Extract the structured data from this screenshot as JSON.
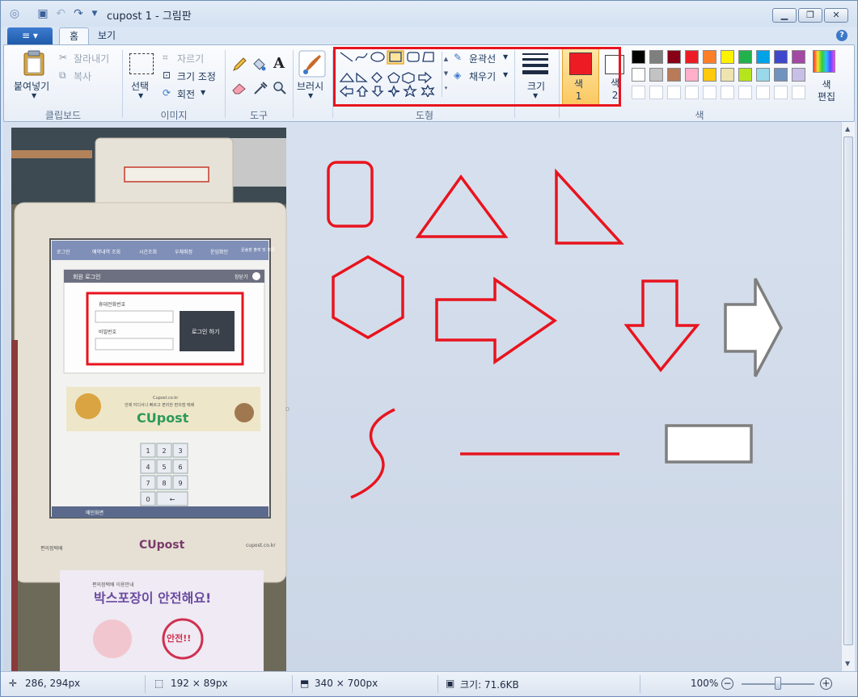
{
  "title_bar": {
    "title": "cupost 1 - 그림판"
  },
  "menu": {
    "file_label": "≡ ▾",
    "tabs": [
      "홈",
      "보기"
    ]
  },
  "clipboard": {
    "paste": "붙여넣기",
    "cut": "잘라내기",
    "copy": "복사",
    "group": "클립보드"
  },
  "image": {
    "select": "선택",
    "crop": "자르기",
    "resize": "크기 조정",
    "rotate": "회전",
    "group": "이미지"
  },
  "tools": {
    "group": "도구"
  },
  "brushes": {
    "label": "브러시"
  },
  "shapes": {
    "outline": "윤곽선",
    "fill": "채우기",
    "group": "도형"
  },
  "size": {
    "label": "크기"
  },
  "colors": {
    "color1_label": "색\n1",
    "color2_label": "색\n2",
    "edit_label": "색\n편집",
    "group": "색",
    "color1": "#ed1c24",
    "color2": "#ffffff",
    "palette_row1": [
      "#000000",
      "#7f7f7f",
      "#880015",
      "#ed1c24",
      "#ff7f27",
      "#fff200",
      "#22b14c",
      "#00a2e8",
      "#3f48cc",
      "#a349a4"
    ],
    "palette_row2": [
      "#ffffff",
      "#c3c3c3",
      "#b97a57",
      "#ffaec9",
      "#ffc90e",
      "#efe4b0",
      "#b5e61d",
      "#99d9ea",
      "#7092be",
      "#c8bfe7"
    ]
  },
  "photo": {
    "kiosk_tabs": [
      "로그인",
      "예약내역 조회",
      "시간조회",
      "우체취정",
      "운임확인",
      "운송장 출력 및 보류"
    ],
    "login_title": "회원 로그인",
    "close": "창닫기",
    "phone_label": "휴대전화번호",
    "password_label": "비밀번호",
    "login_button": "로그인 하기",
    "banner_site": "Cupost.co.kr",
    "banner_text": "언제 어디서나 빠르고 편리한 편의점 택배",
    "brand": "CUpost",
    "keypad": [
      "1",
      "2",
      "3",
      "4",
      "5",
      "6",
      "7",
      "8",
      "9",
      "0",
      "←"
    ],
    "main_screen": "메인화면",
    "footer_left": "편의점택배",
    "footer_right": "cupost.co.kr",
    "poster_small": "편의점택배 이용안내",
    "poster_headline": "박스포장이 안전해요!",
    "stamp": "안전!!"
  },
  "status": {
    "position": "286, 294px",
    "selection": "192 × 89px",
    "image_size": "340 × 700px",
    "file_size": "크기: 71.6KB",
    "zoom": "100%",
    "zoom_level": 0.5
  }
}
